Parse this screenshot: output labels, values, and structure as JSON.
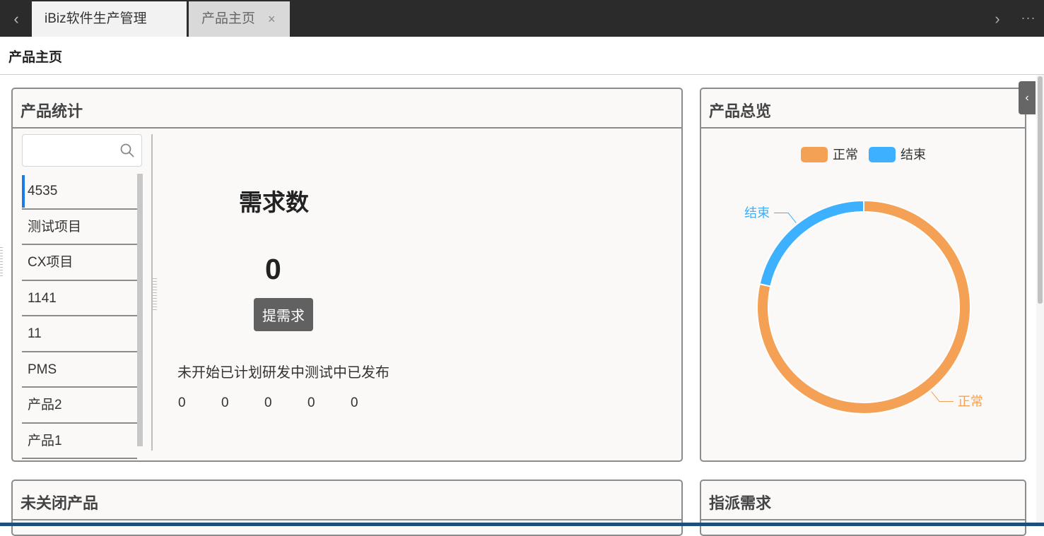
{
  "tabs": [
    {
      "label": "iBiz软件生产管理"
    },
    {
      "label": "产品主页",
      "close": "×"
    }
  ],
  "nav": {
    "prev": "‹",
    "next": "›",
    "more": "···"
  },
  "page_title": "产品主页",
  "cards": {
    "stats": {
      "title": "产品统计"
    },
    "overview": {
      "title": "产品总览"
    },
    "open_products": {
      "title": "未关闭产品"
    },
    "assigned": {
      "title": "指派需求"
    }
  },
  "search": {
    "placeholder": "",
    "value": ""
  },
  "product_list": [
    "4535",
    "测试项目",
    "CX项目",
    "1141",
    "11",
    "PMS",
    "产品2",
    "产品1"
  ],
  "stats": {
    "title": "需求数",
    "count": "0",
    "button": "提需求",
    "labels": "未开始已计划研发中测试中已发布",
    "values": [
      "0",
      "0",
      "0",
      "0",
      "0"
    ]
  },
  "chart_data": {
    "type": "pie",
    "variant": "donut",
    "legend_position": "top",
    "slices": [
      {
        "name": "正常",
        "value": 78.5,
        "color": "#F5A155"
      },
      {
        "name": "结束",
        "value": 21.5,
        "color": "#3DB1FF"
      }
    ]
  },
  "colors": {
    "accent": "#1e7be6",
    "tabbar": "#2b2b2b",
    "button": "#616161"
  }
}
